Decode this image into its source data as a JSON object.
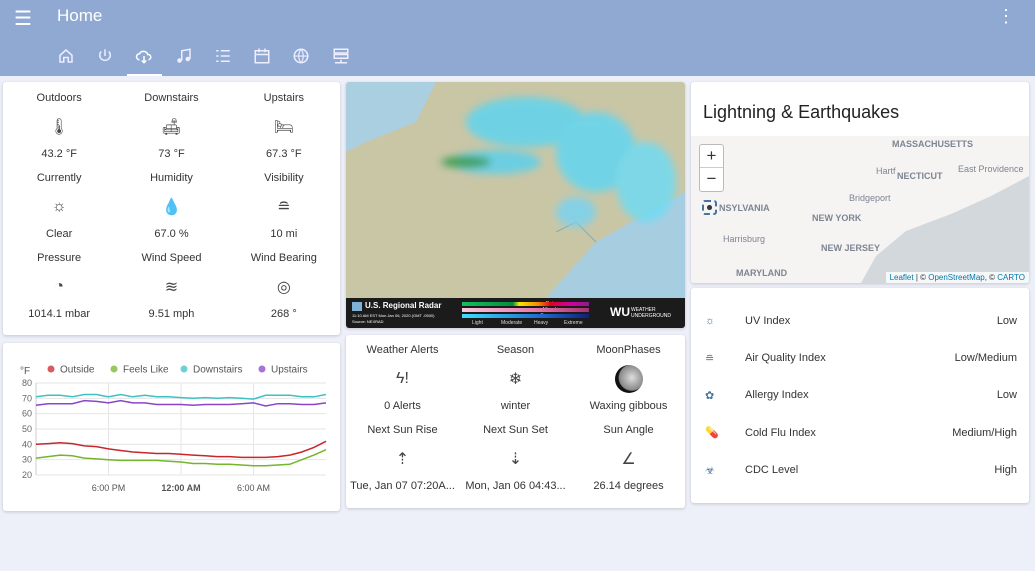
{
  "header": {
    "title": "Home",
    "tabs": [
      "home-icon",
      "power-icon",
      "weather-cloud-icon",
      "music-icon",
      "list-icon",
      "calendar-icon",
      "globe-icon",
      "server-icon"
    ],
    "active_tab": 2
  },
  "sensors": [
    {
      "label": "Outdoors",
      "icon": "thermometer-icon",
      "value": "43.2 °F"
    },
    {
      "label": "Downstairs",
      "icon": "sofa-icon",
      "value": "73 °F"
    },
    {
      "label": "Upstairs",
      "icon": "bed-icon",
      "value": "67.3 °F"
    },
    {
      "label": "Currently",
      "icon": "sun-icon",
      "value": "Clear"
    },
    {
      "label": "Humidity",
      "icon": "water-percent-icon",
      "value": "67.0 %"
    },
    {
      "label": "Visibility",
      "icon": "fog-icon",
      "value": "10 mi"
    },
    {
      "label": "Pressure",
      "icon": "gauge-icon",
      "value": "1014.1 mbar"
    },
    {
      "label": "Wind Speed",
      "icon": "wind-icon",
      "value": "9.51 mph"
    },
    {
      "label": "Wind Bearing",
      "icon": "compass-icon",
      "value": "268 °"
    }
  ],
  "chart_data": {
    "type": "line",
    "ylabel": "°F",
    "ylim": [
      20,
      80
    ],
    "yticks": [
      20,
      30,
      40,
      50,
      60,
      70,
      80
    ],
    "xlim_hours": [
      12,
      36
    ],
    "xticks": [
      {
        "h": 18,
        "label": "6:00 PM",
        "bold": false
      },
      {
        "h": 24,
        "label": "12:00 AM",
        "bold": true
      },
      {
        "h": 30,
        "label": "6:00 AM",
        "bold": false
      }
    ],
    "legend_position": "top",
    "series": [
      {
        "name": "Outside",
        "color": "#c8262c",
        "values": [
          40,
          40.5,
          41,
          40.5,
          39,
          38.5,
          37,
          36,
          35,
          34.5,
          34,
          34,
          33.5,
          33,
          32.5,
          32,
          32,
          31.5,
          31.5,
          31.5,
          32,
          33,
          35,
          38,
          42
        ]
      },
      {
        "name": "Feels Like",
        "color": "#73b52b",
        "values": [
          31,
          32,
          33,
          32.5,
          31,
          30.5,
          30,
          29.5,
          29.5,
          29.5,
          29.5,
          29,
          28.5,
          27.5,
          27.5,
          27,
          27,
          26.5,
          26,
          26,
          26.5,
          27,
          30,
          33,
          36.5
        ]
      },
      {
        "name": "Downstairs",
        "color": "#3cc2c3",
        "values": [
          71,
          72,
          72,
          71,
          72.5,
          72.5,
          71,
          72.5,
          71,
          72,
          71,
          71,
          70.5,
          70,
          70.5,
          70,
          70.5,
          70,
          69.5,
          72,
          72,
          72,
          71,
          71,
          72.5
        ]
      },
      {
        "name": "Upstairs",
        "color": "#8a44c9",
        "values": [
          65.5,
          66.5,
          66.5,
          66.5,
          68.5,
          68,
          67,
          68.5,
          67,
          67,
          66,
          66,
          66,
          65.5,
          66,
          66,
          66,
          66.5,
          67,
          65,
          66.5,
          66.5,
          66,
          66,
          67
        ]
      }
    ]
  },
  "radar": {
    "title": "U.S. Regional Radar",
    "timestamp": "11:10 AM EST Mon Jan 06, 2020 (GMT -0500)",
    "source": "Source: NEXRAD",
    "rows": [
      "Rain",
      "Mixed",
      "Frozen"
    ],
    "scale": [
      "Light",
      "Moderate",
      "Heavy",
      "Extreme"
    ],
    "brand": "WEATHER UNDERGROUND",
    "brand_logo": "WU"
  },
  "info": [
    {
      "label": "Weather Alerts",
      "icon": "lightning-alert-icon",
      "value": "0 Alerts"
    },
    {
      "label": "Season",
      "icon": "snowflake-icon",
      "value": "winter"
    },
    {
      "label": "MoonPhases",
      "icon": "moon-icon",
      "value": "Waxing gibbous"
    },
    {
      "label": "Next Sun Rise",
      "icon": "sunrise-icon",
      "value": "Tue, Jan 07 07:20A..."
    },
    {
      "label": "Next Sun Set",
      "icon": "sunset-icon",
      "value": "Mon, Jan 06 04:43..."
    },
    {
      "label": "Sun Angle",
      "icon": "angle-icon",
      "value": "26.14 degrees"
    }
  ],
  "lightning": {
    "title": "Lightning & Earthquakes",
    "zoom_in": "+",
    "zoom_out": "−",
    "map_labels": [
      "MASSACHUSETTS",
      "Hartf",
      "NECTICUT",
      "East Providence",
      "Bridgeport",
      "NSYLVANIA",
      "NEW YORK",
      "Harrisburg",
      "NEW JERSEY",
      "MARYLAND"
    ],
    "attribution": {
      "leaflet": "Leaflet",
      "sep": " | © ",
      "osm": "OpenStreetMap",
      "sep2": ", © ",
      "carto": "CARTO"
    }
  },
  "indices": [
    {
      "name": "UV Index",
      "value": "Low"
    },
    {
      "name": "Air Quality Index",
      "value": "Low/Medium"
    },
    {
      "name": "Allergy Index",
      "value": "Low"
    },
    {
      "name": "Cold Flu Index",
      "value": "Medium/High"
    },
    {
      "name": "CDC Level",
      "value": "High"
    }
  ]
}
